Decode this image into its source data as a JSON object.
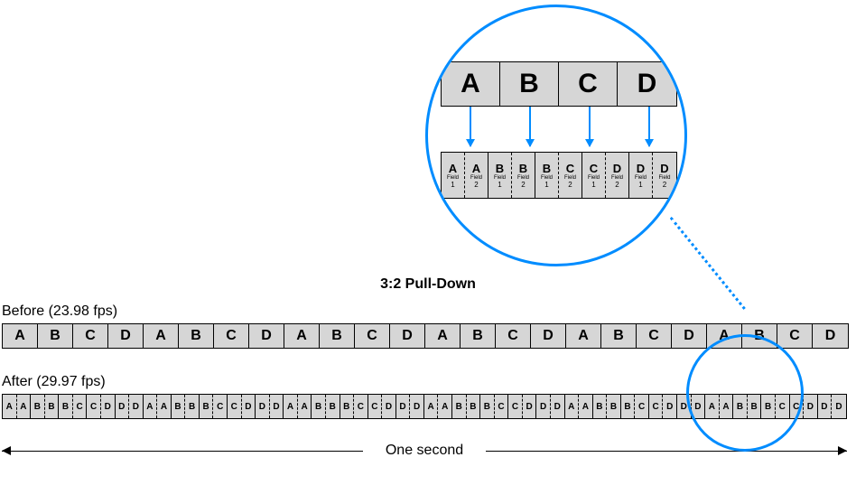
{
  "title": "3:2 Pull-Down",
  "labels": {
    "before": "Before (23.98 fps)",
    "after": "After (29.97 fps)",
    "one_second": "One second"
  },
  "detail": {
    "source_frames": [
      "A",
      "B",
      "C",
      "D"
    ],
    "fields": [
      {
        "letter": "A",
        "field_word": "Field",
        "num": "1",
        "border": "dashed"
      },
      {
        "letter": "A",
        "field_word": "Field",
        "num": "2",
        "border": "solid"
      },
      {
        "letter": "B",
        "field_word": "Field",
        "num": "1",
        "border": "dashed"
      },
      {
        "letter": "B",
        "field_word": "Field",
        "num": "2",
        "border": "solid"
      },
      {
        "letter": "B",
        "field_word": "Field",
        "num": "1",
        "border": "dashed"
      },
      {
        "letter": "C",
        "field_word": "Field",
        "num": "2",
        "border": "solid"
      },
      {
        "letter": "C",
        "field_word": "Field",
        "num": "1",
        "border": "dashed"
      },
      {
        "letter": "D",
        "field_word": "Field",
        "num": "2",
        "border": "solid"
      },
      {
        "letter": "D",
        "field_word": "Field",
        "num": "1",
        "border": "dashed"
      },
      {
        "letter": "D",
        "field_word": "Field",
        "num": "2",
        "border": "none"
      }
    ]
  },
  "before_frames": [
    "A",
    "B",
    "C",
    "D",
    "A",
    "B",
    "C",
    "D",
    "A",
    "B",
    "C",
    "D",
    "A",
    "B",
    "C",
    "D",
    "A",
    "B",
    "C",
    "D",
    "A",
    "B",
    "C",
    "D"
  ],
  "after_fields_pattern": [
    {
      "l": "A",
      "b": "dashed"
    },
    {
      "l": "A",
      "b": "solid"
    },
    {
      "l": "B",
      "b": "dashed"
    },
    {
      "l": "B",
      "b": "solid"
    },
    {
      "l": "B",
      "b": "dashed"
    },
    {
      "l": "C",
      "b": "solid"
    },
    {
      "l": "C",
      "b": "dashed"
    },
    {
      "l": "D",
      "b": "solid"
    },
    {
      "l": "D",
      "b": "dashed"
    },
    {
      "l": "D",
      "b": "solid"
    }
  ],
  "after_repeat": 6
}
